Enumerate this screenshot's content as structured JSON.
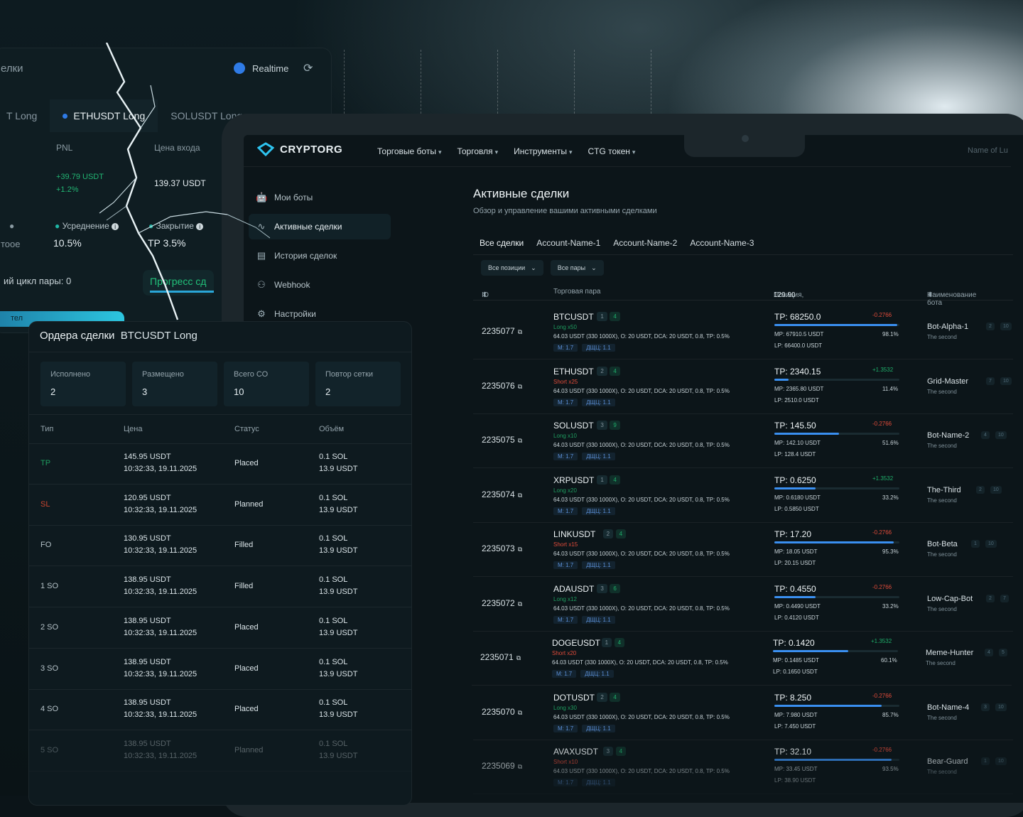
{
  "back_panel": {
    "title_fragment": "елки",
    "realtime_label": "Realtime",
    "tabs": [
      {
        "label": "T Long",
        "active": false
      },
      {
        "label": "ETHUSDT Long",
        "active": true
      },
      {
        "label": "SOLUSDT Long",
        "active": false
      }
    ],
    "pnl_label": "PNL",
    "pnl_value": "+39.79 USDT",
    "pnl_percent": "+1.2%",
    "entry_label": "Цена входа",
    "entry_value": "139.37 USDT",
    "averaging_label": "Усреднение",
    "averaging_value": "10.5%",
    "close_label": "Закрытие",
    "close_value": "TP 3.5%",
    "left_fragment_1": "тоое",
    "cycle_text": "ий цикл пары: 0",
    "progress_label": "Прогресс сд",
    "bottom_fragment": "тел"
  },
  "app": {
    "brand": "CRYPTORG",
    "nav": [
      {
        "label": "Торговые боты"
      },
      {
        "label": "Торговля"
      },
      {
        "label": "Инструменты"
      },
      {
        "label": "CTG токен"
      }
    ],
    "account_name": "Name of Lu",
    "sidebar": [
      {
        "label": "Мои боты",
        "icon": "robot-icon",
        "active": false
      },
      {
        "label": "Активные сделки",
        "icon": "pulse-icon",
        "active": true
      },
      {
        "label": "История сделок",
        "icon": "document-icon",
        "active": false
      },
      {
        "label": "Webhook",
        "icon": "webhook-icon",
        "active": false
      },
      {
        "label": "Настройки",
        "icon": "gear-icon",
        "active": false
      }
    ],
    "page_title": "Активные сделки",
    "page_subtitle": "Обзор и управление вашими активными сделками",
    "account_tabs": [
      "Все сделки",
      "Account-Name-1",
      "Account-Name-2",
      "Account-Name-3"
    ],
    "filters": [
      "Все позиции",
      "Все пары"
    ],
    "columns": {
      "id": "ID",
      "pair": "Торговая пара",
      "position": "Позиция,",
      "position_total": "129.90",
      "bot": "Наименование бота"
    },
    "trades": [
      {
        "id": "2235077",
        "pair": "BTCUSDT",
        "b1": "1",
        "b2": "4",
        "dir": "Long x50",
        "side": "long",
        "info": "64.03 USDT (330 1000X), O: 20 USDT, DCA: 20 USDT, 0.8, TP: 0.5%",
        "m": "М: 1.7",
        "d": "ДЩЦ: 1.1",
        "tp": "TP: 68250.0",
        "delta": "-0.2766",
        "delta_sign": "neg",
        "progress": 98.1,
        "mp": "MP: 67910.5 USDT",
        "pct": "98.1%",
        "lp": "LP: 66400.0 USDT",
        "bot": "Bot-Alpha-1",
        "bb1": "2",
        "bb2": "10",
        "bot_sub": "The second"
      },
      {
        "id": "2235076",
        "pair": "ETHUSDT",
        "b1": "2",
        "b2": "4",
        "dir": "Short x25",
        "side": "short",
        "info": "64.03 USDT (330 1000X), O: 20 USDT, DCA: 20 USDT, 0.8, TP: 0.5%",
        "m": "М: 1.7",
        "d": "ДЩЦ: 1.1",
        "tp": "TP: 2340.15",
        "delta": "+1.3532",
        "delta_sign": "pos",
        "progress": 11.4,
        "mp": "MP: 2365.80 USDT",
        "pct": "11.4%",
        "lp": "LP: 2510.0 USDT",
        "bot": "Grid-Master",
        "bb1": "7",
        "bb2": "10",
        "bot_sub": "The second"
      },
      {
        "id": "2235075",
        "pair": "SOLUSDT",
        "b1": "3",
        "b2": "9",
        "dir": "Long x10",
        "side": "long",
        "info": "64.03 USDT (330 1000X), O: 20 USDT, DCA: 20 USDT, 0.8, TP: 0.5%",
        "m": "М: 1.7",
        "d": "ДЩЦ: 1.1",
        "tp": "TP: 145.50",
        "delta": "-0.2766",
        "delta_sign": "neg",
        "progress": 51.6,
        "mp": "MP: 142.10 USDT",
        "pct": "51.6%",
        "lp": "LP: 128.4 USDT",
        "bot": "Bot-Name-2",
        "bb1": "4",
        "bb2": "10",
        "bot_sub": "The second"
      },
      {
        "id": "2235074",
        "pair": "XRPUSDT",
        "b1": "1",
        "b2": "4",
        "dir": "Long x20",
        "side": "long",
        "info": "64.03 USDT (330 1000X), O: 20 USDT, DCA: 20 USDT, 0.8, TP: 0.5%",
        "m": "М: 1.7",
        "d": "ДЩЦ: 1.1",
        "tp": "TP: 0.6250",
        "delta": "+1.3532",
        "delta_sign": "pos",
        "progress": 33.2,
        "mp": "MP: 0.6180 USDT",
        "pct": "33.2%",
        "lp": "LP: 0.5850 USDT",
        "bot": "The-Third",
        "bb1": "2",
        "bb2": "10",
        "bot_sub": "The second"
      },
      {
        "id": "2235073",
        "pair": "LINKUSDT",
        "b1": "2",
        "b2": "4",
        "dir": "Short x15",
        "side": "short",
        "info": "64.03 USDT (330 1000X), O: 20 USDT, DCA: 20 USDT, 0.8, TP: 0.5%",
        "m": "М: 1.7",
        "d": "ДЩЦ: 1.1",
        "tp": "TP: 17.20",
        "delta": "-0.2766",
        "delta_sign": "neg",
        "progress": 95.3,
        "mp": "MP: 18.05 USDT",
        "pct": "95.3%",
        "lp": "LP: 20.15 USDT",
        "bot": "Bot-Beta",
        "bb1": "1",
        "bb2": "10",
        "bot_sub": "The second"
      },
      {
        "id": "2235072",
        "pair": "ADAUSDT",
        "b1": "3",
        "b2": "6",
        "dir": "Long x12",
        "side": "long",
        "info": "64.03 USDT (330 1000X), O: 20 USDT, DCA: 20 USDT, 0.8, TP: 0.5%",
        "m": "М: 1.7",
        "d": "ДЩЦ: 1.1",
        "tp": "TP: 0.4550",
        "delta": "-0.2766",
        "delta_sign": "neg",
        "progress": 33.2,
        "mp": "MP: 0.4490 USDT",
        "pct": "33.2%",
        "lp": "LP: 0.4120 USDT",
        "bot": "Low-Cap-Bot",
        "bb1": "2",
        "bb2": "7",
        "bot_sub": "The second"
      },
      {
        "id": "2235071",
        "pair": "DOGEUSDT",
        "b1": "1",
        "b2": "4",
        "dir": "Short x20",
        "side": "short",
        "info": "64.03 USDT (330 1000X), O: 20 USDT, DCA: 20 USDT, 0.8, TP: 0.5%",
        "m": "М: 1.7",
        "d": "ДЩЦ: 1.1",
        "tp": "TP: 0.1420",
        "delta": "+1.3532",
        "delta_sign": "pos",
        "progress": 60.1,
        "mp": "MP: 0.1485 USDT",
        "pct": "60.1%",
        "lp": "LP: 0.1650 USDT",
        "bot": "Meme-Hunter",
        "bb1": "4",
        "bb2": "5",
        "bot_sub": "The second"
      },
      {
        "id": "2235070",
        "pair": "DOTUSDT",
        "b1": "2",
        "b2": "4",
        "dir": "Long x30",
        "side": "long",
        "info": "64.03 USDT (330 1000X), O: 20 USDT, DCA: 20 USDT, 0.8, TP: 0.5%",
        "m": "М: 1.7",
        "d": "ДЩЦ: 1.1",
        "tp": "TP: 8.250",
        "delta": "-0.2766",
        "delta_sign": "neg",
        "progress": 85.7,
        "mp": "MP: 7.980 USDT",
        "pct": "85.7%",
        "lp": "LP: 7.450 USDT",
        "bot": "Bot-Name-4",
        "bb1": "3",
        "bb2": "10",
        "bot_sub": "The second"
      },
      {
        "id": "2235069",
        "pair": "AVAXUSDT",
        "b1": "3",
        "b2": "4",
        "dir": "Short x10",
        "side": "short",
        "info": "64.03 USDT (330 1000X), O: 20 USDT, DCA: 20 USDT, 0.8, TP: 0.5%",
        "m": "М: 1.7",
        "d": "ДЩЦ: 1.1",
        "tp": "TP: 32.10",
        "delta": "-0.2766",
        "delta_sign": "neg",
        "progress": 93.5,
        "mp": "MP: 33.45 USDT",
        "pct": "93.5%",
        "lp": "LP: 38.90 USDT",
        "bot": "Bear-Guard",
        "bb1": "1",
        "bb2": "10",
        "bot_sub": "The second"
      }
    ]
  },
  "orders_panel": {
    "title": "Ордера сделки",
    "pair": "BTCUSDT Long",
    "stats": [
      {
        "label": "Исполнено",
        "value": "2"
      },
      {
        "label": "Размещено",
        "value": "3"
      },
      {
        "label": "Всего СО",
        "value": "10"
      },
      {
        "label": "Повтор сетки",
        "value": "2"
      }
    ],
    "columns": [
      "Тип",
      "Цена",
      "Статус",
      "Объём"
    ],
    "rows": [
      {
        "type": "TP",
        "cls": "tp",
        "price": "145.95 USDT",
        "time": "10:32:33, 19.11.2025",
        "status": "Placed",
        "vol1": "0.1 SOL",
        "vol2": "13.9 USDT"
      },
      {
        "type": "SL",
        "cls": "sl",
        "price": "120.95 USDT",
        "time": "10:32:33, 19.11.2025",
        "status": "Planned",
        "vol1": "0.1 SOL",
        "vol2": "13.9 USDT"
      },
      {
        "type": "FO",
        "cls": "",
        "price": "130.95 USDT",
        "time": "10:32:33, 19.11.2025",
        "status": "Filled",
        "vol1": "0.1 SOL",
        "vol2": "13.9 USDT"
      },
      {
        "type": "1 SO",
        "cls": "",
        "price": "138.95 USDT",
        "time": "10:32:33, 19.11.2025",
        "status": "Filled",
        "vol1": "0.1 SOL",
        "vol2": "13.9 USDT"
      },
      {
        "type": "2 SO",
        "cls": "",
        "price": "138.95 USDT",
        "time": "10:32:33, 19.11.2025",
        "status": "Placed",
        "vol1": "0.1 SOL",
        "vol2": "13.9 USDT"
      },
      {
        "type": "3 SO",
        "cls": "",
        "price": "138.95 USDT",
        "time": "10:32:33, 19.11.2025",
        "status": "Placed",
        "vol1": "0.1 SOL",
        "vol2": "13.9 USDT"
      },
      {
        "type": "4 SO",
        "cls": "",
        "price": "138.95 USDT",
        "time": "10:32:33, 19.11.2025",
        "status": "Placed",
        "vol1": "0.1 SOL",
        "vol2": "13.9 USDT"
      },
      {
        "type": "5 SO",
        "cls": "",
        "price": "138.95 USDT",
        "time": "10:32:33, 19.11.2025",
        "status": "Planned",
        "vol1": "0.1 SOL",
        "vol2": "13.9 USDT"
      }
    ]
  }
}
